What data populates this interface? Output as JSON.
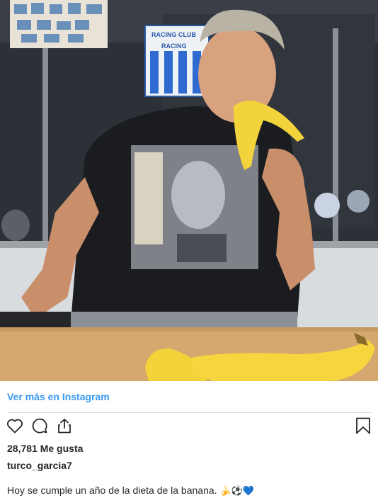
{
  "photo": {
    "banner_text_top": "RACING CLUB",
    "banner_text_mid": "RACING"
  },
  "links": {
    "view_more": "Ver más en Instagram"
  },
  "actions": {
    "like_icon": "heart-icon",
    "comment_icon": "comment-icon",
    "share_icon": "share-icon",
    "save_icon": "bookmark-icon"
  },
  "likes": {
    "text": "28,781 Me gusta"
  },
  "post": {
    "username": "turco_garcia7",
    "caption": "Hoy se cumple un año de la dieta de la banana.",
    "caption_emojis": "🍌⚽💙"
  },
  "colors": {
    "link": "#3897f0",
    "text": "#262626",
    "divider": "#dbdbdb"
  }
}
